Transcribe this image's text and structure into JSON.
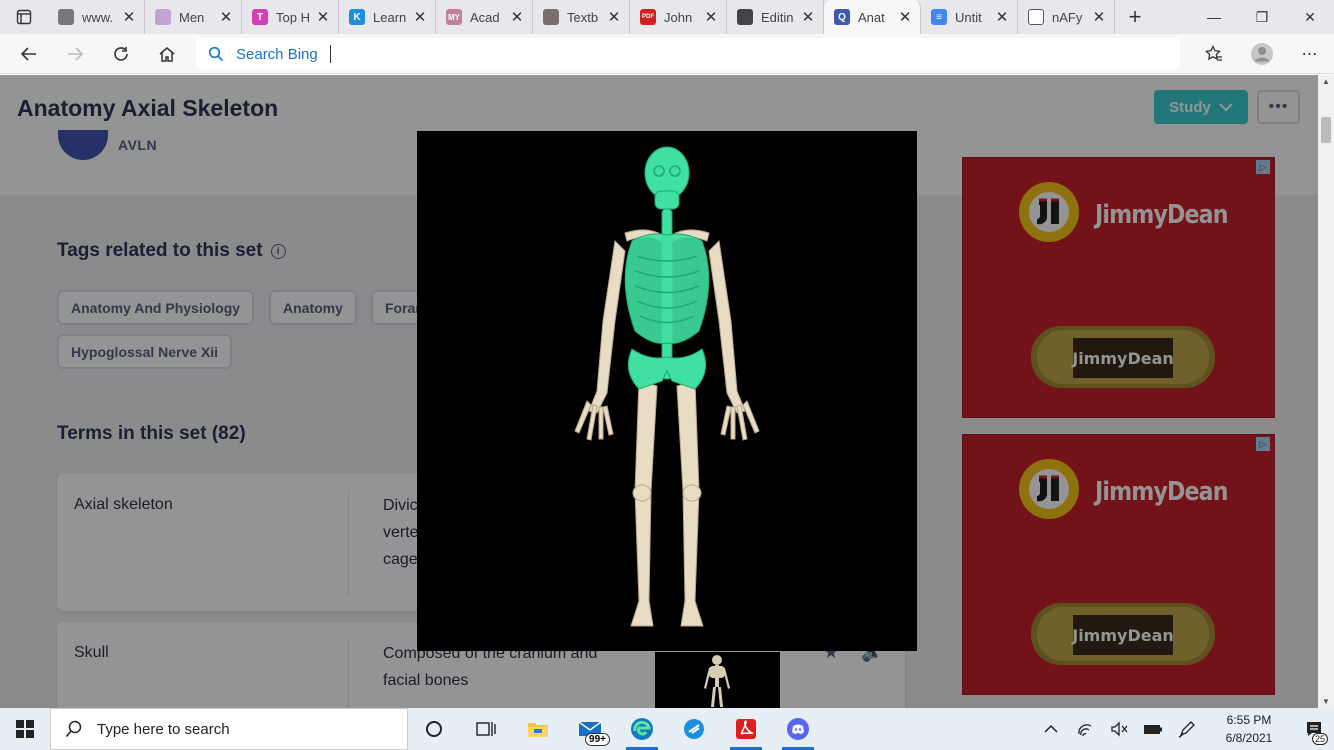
{
  "browser": {
    "tabs": [
      {
        "label": "www.",
        "color": "#777",
        "glyph": "",
        "active": false
      },
      {
        "label": "Men",
        "color": "#c2a3d6",
        "glyph": "",
        "active": false
      },
      {
        "label": "Top H",
        "color": "#d63fb4",
        "glyph": "T",
        "active": false
      },
      {
        "label": "Learn",
        "color": "#1d8fe0",
        "glyph": "K",
        "active": false
      },
      {
        "label": "Acad",
        "color": "#c0809b",
        "glyph": "MY",
        "active": false
      },
      {
        "label": "Textb",
        "color": "#7a6e6e",
        "glyph": "",
        "active": false
      },
      {
        "label": "John",
        "color": "#d11f1f",
        "glyph": "PDF",
        "active": false
      },
      {
        "label": "Editin",
        "color": "#444",
        "glyph": "",
        "active": false
      },
      {
        "label": "Anat",
        "color": "#4257b2",
        "glyph": "Q",
        "active": true
      },
      {
        "label": "Untit",
        "color": "#4285f4",
        "glyph": "≡",
        "active": false
      },
      {
        "label": "nAFy",
        "color": "#fff",
        "glyph": "",
        "active": false
      }
    ],
    "search_placeholder": "Search Bing"
  },
  "header": {
    "title": "Anatomy Axial Skeleton",
    "username": "AVLN",
    "study_label": "Study",
    "more_label": "•••"
  },
  "tags_section": {
    "title": "Tags related to this set",
    "tags": [
      "Anatomy And Physiology",
      "Anatomy",
      "Foran",
      "Hypoglossal Nerve Xii"
    ]
  },
  "terms_section": {
    "title": "Terms in this set (82)",
    "cards": [
      {
        "term": "Axial skeleton",
        "definition_lines": [
          "Divic",
          "verte",
          "cage"
        ]
      },
      {
        "term": "Skull",
        "definition_lines": [
          "Composed of the cranium and",
          "facial bones"
        ]
      }
    ]
  },
  "ads": [
    {
      "brand": "JimmyDean",
      "product": "JimmyDean"
    },
    {
      "brand": "JimmyDean",
      "product": "JimmyDean"
    }
  ],
  "taskbar": {
    "search_placeholder": "Type here to search",
    "mail_badge": "99+",
    "time": "6:55 PM",
    "date": "6/8/2021",
    "notification_count": "25"
  },
  "colors": {
    "accent": "#3ccfcf",
    "title": "#2e3856",
    "axial_bone": "#3fe0a0",
    "appendicular_bone": "#e8dcc4",
    "ad_red": "#c9202e"
  }
}
